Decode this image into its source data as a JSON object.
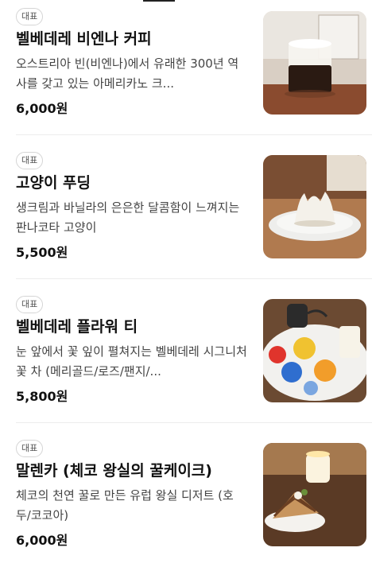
{
  "menu": {
    "items": [
      {
        "badge": "대표",
        "name": "벨베데레 비엔나 커피",
        "description": "오스트리아 빈(비엔나)에서 유래한 300년 역사를 갖고 있는 아메리카노 크...",
        "price": "6,000원"
      },
      {
        "badge": "대표",
        "name": "고양이 푸딩",
        "description": "생크림과 바닐라의 은은한 달콤함이 느껴지는 판나코타 고양이",
        "price": "5,500원"
      },
      {
        "badge": "대표",
        "name": "벨베데레 플라워 티",
        "description": "눈 앞에서 꽃 잎이 펼쳐지는 벨베데레 시그니처 꽃 차 (메리골드/로즈/팬지/...",
        "price": "5,800원"
      },
      {
        "badge": "대표",
        "name": "말렌카 (체코 왕실의 꿀케이크)",
        "description": "체코의 천연 꿀로 만든 유럽 왕실 디저트 (호두/코코아)",
        "price": "6,000원"
      }
    ]
  }
}
